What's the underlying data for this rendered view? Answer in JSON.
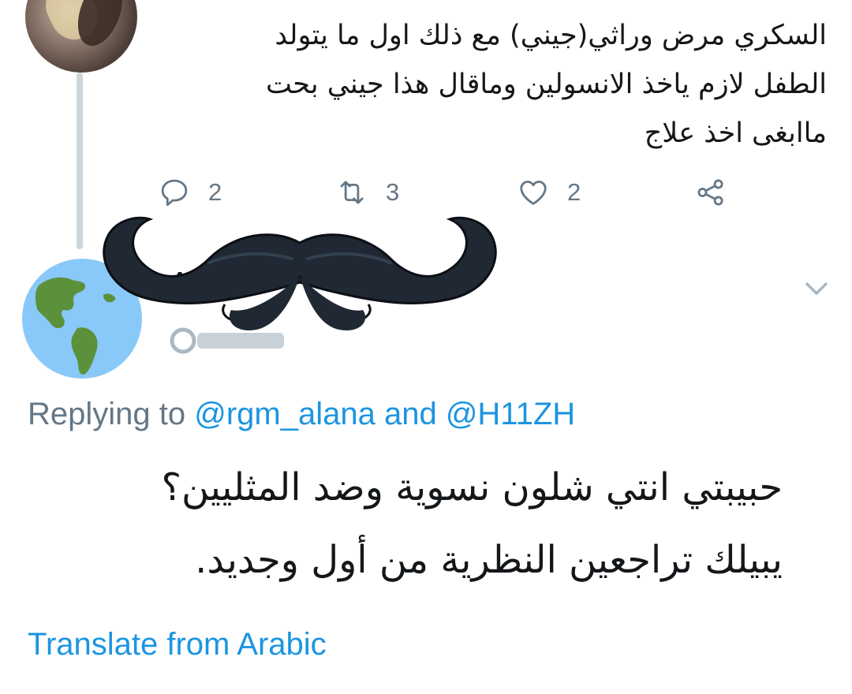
{
  "parent_tweet": {
    "text_lines": [
      "السكري مرض وراثي(جيني) مع ذلك اول ما يتولد",
      "الطفل لازم ياخذ الانسولين وماقال هذا جيني بحت",
      "ماابغى اخذ علاج"
    ],
    "actions": {
      "reply_count": "2",
      "retweet_count": "3",
      "like_count": "2"
    }
  },
  "reply_tweet": {
    "replying_prefix": "Replying to ",
    "mention_1": "@rgm_alana",
    "and_word": " and ",
    "mention_2": "@H11ZH",
    "text_lines": [
      "حبيبتي انتي شلون نسوية وضد المثليين؟",
      "يبيلك تراجعين النظرية من أول وجديد."
    ],
    "translate_label": "Translate from Arabic"
  },
  "icons": {
    "reply": "reply-bubble-icon",
    "retweet": "retweet-icon",
    "like": "heart-icon",
    "share": "share-icon",
    "more": "chevron-down-icon",
    "avatar_default": "globe-icon",
    "redaction": "mustache-sticker"
  },
  "colors": {
    "text_primary": "#14171a",
    "text_secondary": "#657786",
    "link": "#1b95e0",
    "thread_line": "#ccd6dd"
  }
}
